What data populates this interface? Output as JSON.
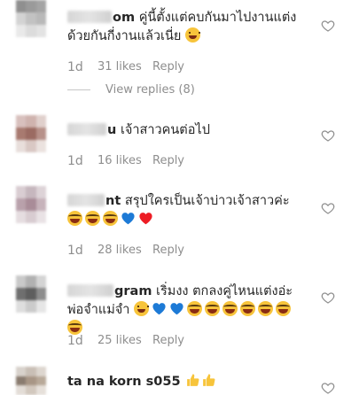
{
  "comments": [
    {
      "username_visible": "om",
      "text": "คู่นี้ตั้งแต่คบกันมาไปงานแต่งด้วยกันกี่งานแล้วเนี่ย",
      "age": "1d",
      "likes": "31 likes",
      "reply": "Reply",
      "view_replies": "View replies (8)"
    },
    {
      "username_visible": "u",
      "text": "เจ้าสาวคนต่อไป",
      "age": "1d",
      "likes": "16 likes",
      "reply": "Reply"
    },
    {
      "username_visible": "nt",
      "text": "สรุปใครเป็นเจ้าบ่าวเจ้าสาวค่ะ",
      "age": "1d",
      "likes": "28 likes",
      "reply": "Reply"
    },
    {
      "username_visible": "gram",
      "text": "เริ่มงง ตกลงคู่ไหนแต่งอ่ะพ่อจำแม่จำ",
      "age": "1d",
      "likes": "25 likes",
      "reply": "Reply"
    },
    {
      "username_visible": "ta_na_korn_s055",
      "text": ""
    }
  ],
  "colors": {
    "text": "#262626",
    "meta": "#8e8e8e",
    "heart_outline": "#8e8e8e",
    "red_heart": "#ed1c24",
    "blue_heart": "#1d7ad6"
  },
  "icons": [
    "heart-outline-icon",
    "laugh-emoji-icon",
    "smile-emoji-icon",
    "blue-heart-emoji-icon",
    "red-heart-emoji-icon",
    "thumbs-up-emoji-icon"
  ]
}
